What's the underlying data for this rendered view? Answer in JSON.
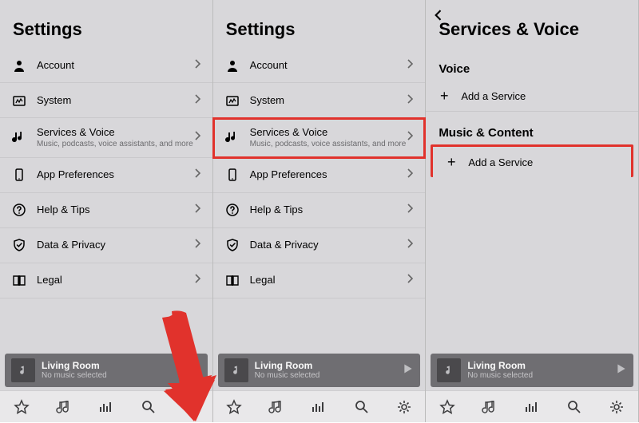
{
  "panel1": {
    "title": "Settings",
    "items": [
      {
        "label": "Account",
        "sub": ""
      },
      {
        "label": "System",
        "sub": ""
      },
      {
        "label": "Services & Voice",
        "sub": "Music, podcasts, voice assistants, and more"
      },
      {
        "label": "App Preferences",
        "sub": ""
      },
      {
        "label": "Help & Tips",
        "sub": ""
      },
      {
        "label": "Data & Privacy",
        "sub": ""
      },
      {
        "label": "Legal",
        "sub": ""
      }
    ],
    "now_playing": {
      "room": "Living Room",
      "status": "No music selected"
    }
  },
  "panel2": {
    "title": "Settings",
    "items": [
      {
        "label": "Account",
        "sub": ""
      },
      {
        "label": "System",
        "sub": ""
      },
      {
        "label": "Services & Voice",
        "sub": "Music, podcasts, voice assistants, and more"
      },
      {
        "label": "App Preferences",
        "sub": ""
      },
      {
        "label": "Help & Tips",
        "sub": ""
      },
      {
        "label": "Data & Privacy",
        "sub": ""
      },
      {
        "label": "Legal",
        "sub": ""
      }
    ],
    "now_playing": {
      "room": "Living Room",
      "status": "No music selected"
    }
  },
  "panel3": {
    "title": "Services & Voice",
    "section1": "Voice",
    "add1": "Add a Service",
    "section2": "Music & Content",
    "add2": "Add a Service",
    "now_playing": {
      "room": "Living Room",
      "status": "No music selected"
    }
  }
}
